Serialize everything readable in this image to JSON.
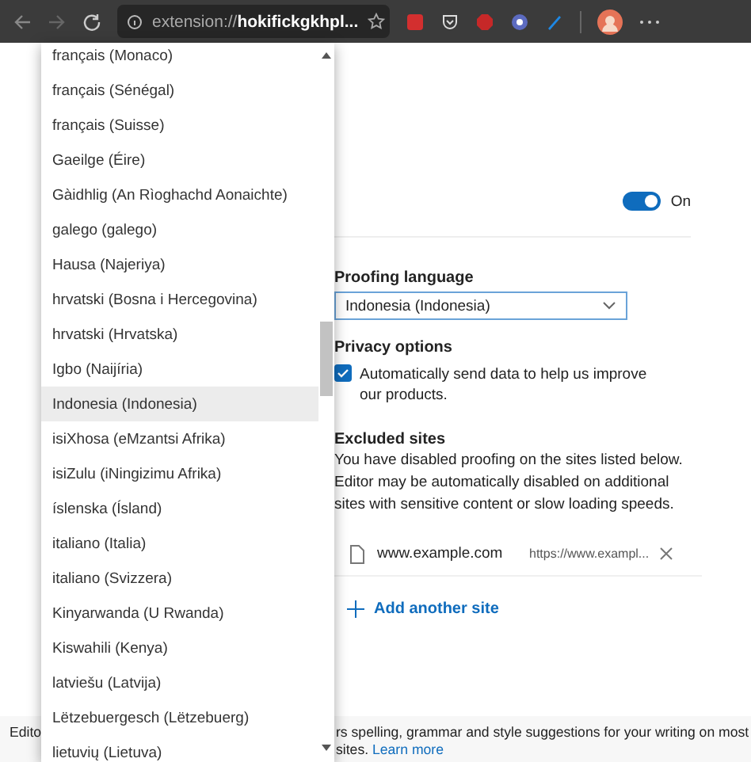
{
  "toolbar": {
    "address": "extension://**hokifickgkhpl...**"
  },
  "editor": {
    "toggle": {
      "on": true,
      "label": "On"
    },
    "proofing": {
      "label": "Proofing language",
      "value": "Indonesia (Indonesia)"
    },
    "privacy": {
      "label": "Privacy options",
      "checked": true,
      "text": "Automatically send data to help us improve our products."
    },
    "excluded": {
      "title": "Excluded sites",
      "description": "You have disabled proofing on the sites listed below. Editor may be automatically disabled on additional sites with sensitive content or slow loading speeds.",
      "sites": [
        {
          "name": "www.example.com",
          "url": "https://www.exampl..."
        }
      ],
      "add": "Add another site"
    }
  },
  "footer": {
    "left": "Edito",
    "line_1": "rs spelling, grammar and style suggestions for your writing on most",
    "line_2": "sites.",
    "link": "Learn more"
  },
  "dropdown": {
    "items": [
      {
        "label": "français (Monaco)",
        "selected": false
      },
      {
        "label": "français (Sénégal)",
        "selected": false
      },
      {
        "label": "français (Suisse)",
        "selected": false
      },
      {
        "label": "Gaeilge (Éire)",
        "selected": false
      },
      {
        "label": "Gàidhlig (An Rìoghachd Aonaichte)",
        "selected": false
      },
      {
        "label": "galego (galego)",
        "selected": false
      },
      {
        "label": "Hausa (Najeriya)",
        "selected": false
      },
      {
        "label": "hrvatski (Bosna i Hercegovina)",
        "selected": false
      },
      {
        "label": "hrvatski (Hrvatska)",
        "selected": false
      },
      {
        "label": "Igbo (Naijíria)",
        "selected": false
      },
      {
        "label": "Indonesia (Indonesia)",
        "selected": true
      },
      {
        "label": "isiXhosa (eMzantsi Afrika)",
        "selected": false
      },
      {
        "label": "isiZulu (iNingizimu Afrika)",
        "selected": false
      },
      {
        "label": "íslenska (Ísland)",
        "selected": false
      },
      {
        "label": "italiano (Italia)",
        "selected": false
      },
      {
        "label": "italiano (Svizzera)",
        "selected": false
      },
      {
        "label": "Kinyarwanda (U Rwanda)",
        "selected": false
      },
      {
        "label": "Kiswahili (Kenya)",
        "selected": false
      },
      {
        "label": "latviešu (Latvija)",
        "selected": false
      },
      {
        "label": "Lëtzebuergesch (Lëtzebuerg)",
        "selected": false
      },
      {
        "label": "lietuvių (Lietuva)",
        "selected": false
      }
    ]
  }
}
